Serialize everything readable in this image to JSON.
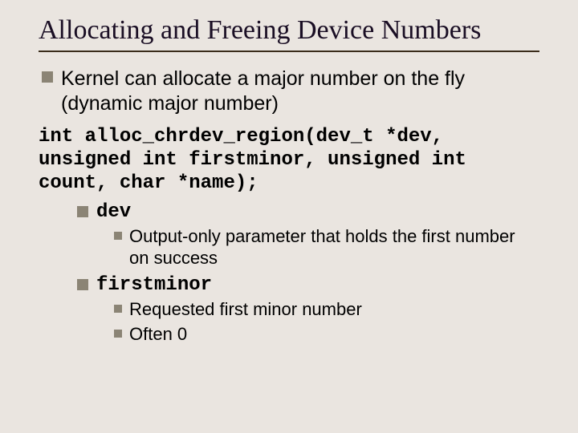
{
  "title": "Allocating and Freeing Device Numbers",
  "b1": "Kernel can allocate a major number on the fly (dynamic major number)",
  "code": "int alloc_chrdev_region(dev_t *dev, unsigned int firstminor, unsigned int count, char *name);",
  "p1": {
    "name": "dev",
    "d1": "Output-only parameter that holds the first number on success"
  },
  "p2": {
    "name": "firstminor",
    "d1": "Requested first minor number",
    "d2": "Often 0"
  }
}
